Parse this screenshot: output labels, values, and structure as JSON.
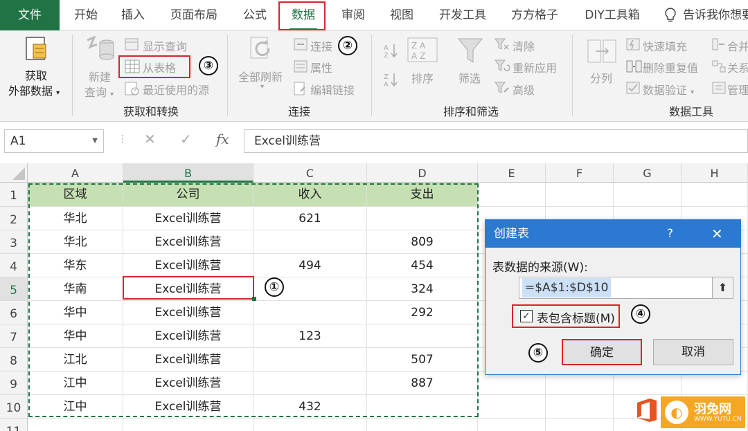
{
  "tabs": {
    "file": "文件",
    "home": "开始",
    "insert": "插入",
    "layout": "页面布局",
    "formulas": "公式",
    "data": "数据",
    "review": "审阅",
    "view": "视图",
    "developer": "开发工具",
    "ffgz": "方方格子",
    "diy": "DIY工具箱",
    "tell_me": "告诉我你想要"
  },
  "ribbon": {
    "get_external": [
      "获取",
      "外部数据"
    ],
    "new_query": [
      "新建",
      "查询"
    ],
    "show_query": "显示查询",
    "from_table": "从表格",
    "recent_sources": "最近使用的源",
    "group_get_transform": "获取和转换",
    "refresh_all": "全部刷新",
    "connections": "连接",
    "properties": "属性",
    "edit_links": "编辑链接",
    "group_connections": "连接",
    "sort": "排序",
    "filter": "筛选",
    "clear": "清除",
    "reapply": "重新应用",
    "advanced": "高级",
    "group_sort_filter": "排序和筛选",
    "text_to_columns": "分列",
    "flash_fill": "快速填充",
    "remove_duplicates": "删除重复值",
    "data_validation": "数据验证",
    "consolidate": "合并",
    "relationships": "关系",
    "manage": "管理",
    "group_data_tools": "数据工具"
  },
  "formula_bar": {
    "name_box": "A1",
    "content": "Excel训练营"
  },
  "columns": [
    "A",
    "B",
    "C",
    "D",
    "E",
    "F",
    "G",
    "H"
  ],
  "rows": [
    "1",
    "2",
    "3",
    "4",
    "5",
    "6",
    "7",
    "8",
    "9",
    "10",
    "11"
  ],
  "table": {
    "headers": [
      "区域",
      "公司",
      "收入",
      "支出"
    ],
    "rows": [
      [
        "华北",
        "Excel训练营",
        "621",
        ""
      ],
      [
        "华北",
        "Excel训练营",
        "",
        "809"
      ],
      [
        "华东",
        "Excel训练营",
        "494",
        "454"
      ],
      [
        "华南",
        "Excel训练营",
        "",
        "324"
      ],
      [
        "华中",
        "Excel训练营",
        "",
        "292"
      ],
      [
        "华中",
        "Excel训练营",
        "123",
        ""
      ],
      [
        "江北",
        "Excel训练营",
        "",
        "507"
      ],
      [
        "江中",
        "Excel训练营",
        "",
        "887"
      ],
      [
        "江中",
        "Excel训练营",
        "432",
        ""
      ]
    ]
  },
  "dialog": {
    "title": "创建表",
    "help": "?",
    "close": "✕",
    "source_label": "表数据的来源(W):",
    "range": "=$A$1:$D$10",
    "header_checkbox": "表包含标题(M)",
    "header_checked": true,
    "ok": "确定",
    "cancel": "取消"
  },
  "steps": [
    "①",
    "②",
    "③",
    "④",
    "⑤"
  ],
  "watermark": {
    "name": "羽兔网",
    "url": "WWW.YUTU.CN"
  },
  "colors": {
    "excel_green": "#217346",
    "header_fill": "#c6e0b4",
    "dialog_blue": "#2b79d0",
    "highlight_red": "#d9242b"
  }
}
